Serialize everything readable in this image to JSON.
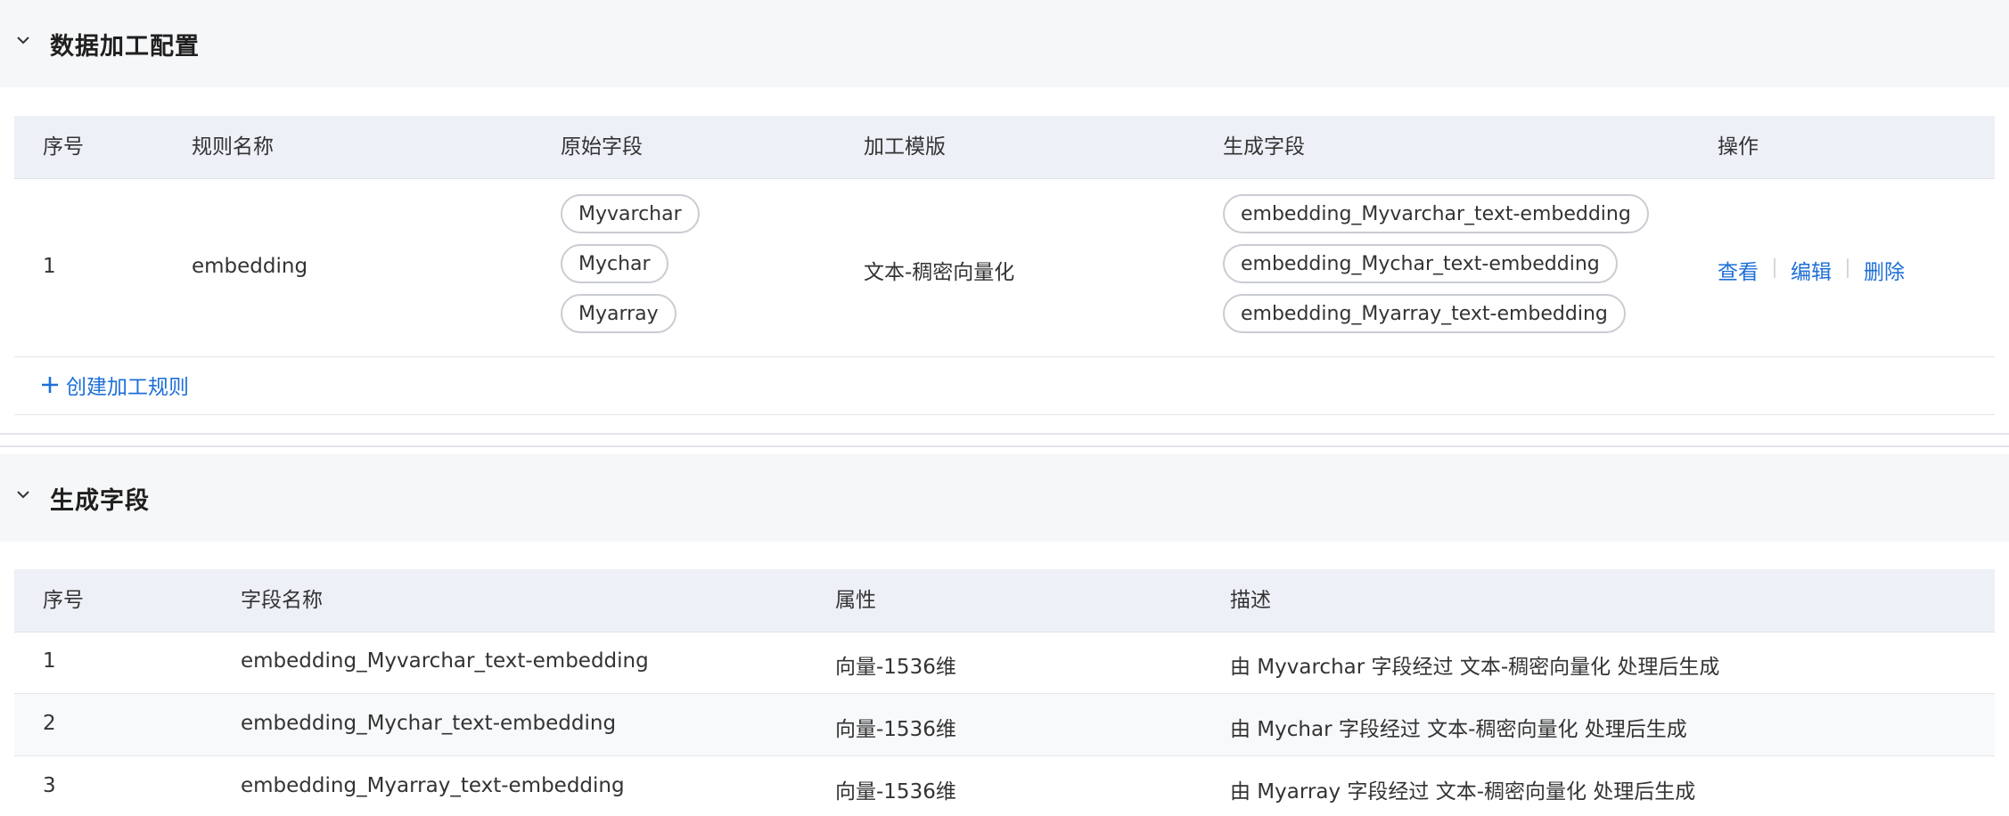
{
  "processing_config": {
    "title": "数据加工配置",
    "columns": [
      "序号",
      "规则名称",
      "原始字段",
      "加工模版",
      "生成字段",
      "操作"
    ],
    "rows": [
      {
        "index": "1",
        "rule_name": "embedding",
        "source_fields": [
          "Myvarchar",
          "Mychar",
          "Myarray"
        ],
        "template": "文本-稠密向量化",
        "generated_fields": [
          "embedding_Myvarchar_text-embedding",
          "embedding_Mychar_text-embedding",
          "embedding_Myarray_text-embedding"
        ],
        "actions": [
          "查看",
          "编辑",
          "删除"
        ]
      }
    ],
    "create_label": "创建加工规则"
  },
  "generated_fields": {
    "title": "生成字段",
    "columns": [
      "序号",
      "字段名称",
      "属性",
      "描述"
    ],
    "rows": [
      {
        "index": "1",
        "name": "embedding_Myvarchar_text-embedding",
        "attribute": "向量-1536维",
        "description": "由 Myvarchar 字段经过 文本-稠密向量化 处理后生成"
      },
      {
        "index": "2",
        "name": "embedding_Mychar_text-embedding",
        "attribute": "向量-1536维",
        "description": "由 Mychar 字段经过 文本-稠密向量化 处理后生成"
      },
      {
        "index": "3",
        "name": "embedding_Myarray_text-embedding",
        "attribute": "向量-1536维",
        "description": "由 Myarray 字段经过 文本-稠密向量化 处理后生成"
      }
    ]
  },
  "colors": {
    "link": "#1d6fd6",
    "header_bg": "#edf0f7",
    "section_bg": "#f6f7f9"
  },
  "icons": {
    "collapse": "chevron-down-icon",
    "create": "plus-icon"
  }
}
